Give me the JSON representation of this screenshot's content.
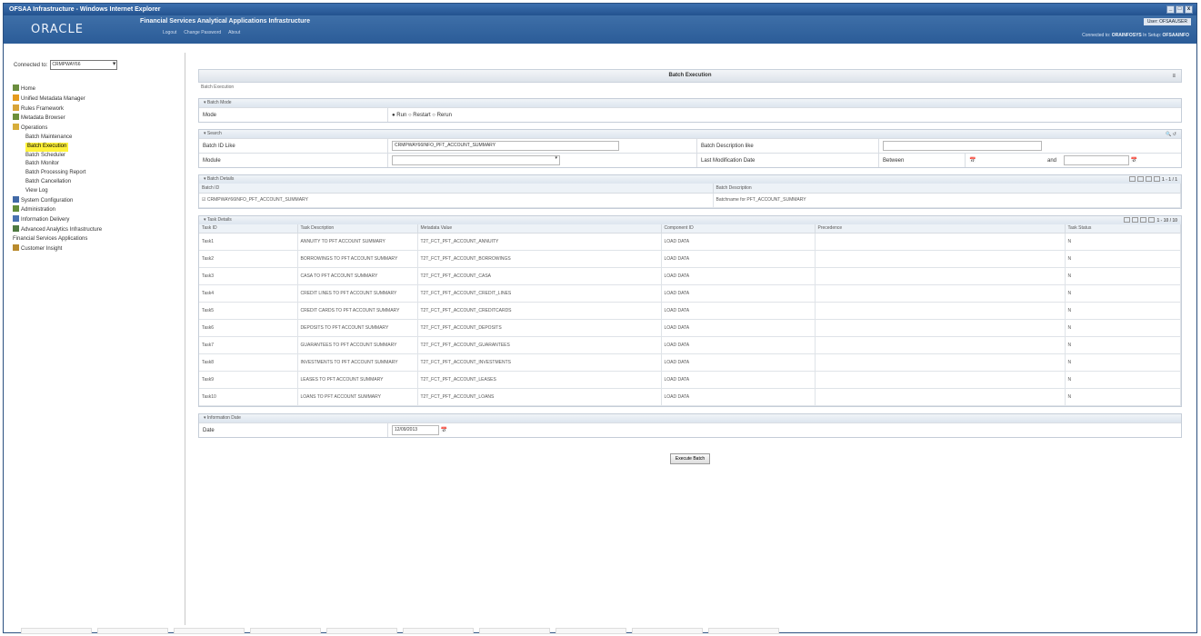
{
  "window": {
    "title": "OFSAA Infrastructure - Windows Internet Explorer",
    "controls": [
      "_",
      "□",
      "x"
    ]
  },
  "banner": {
    "logo": "ORACLE",
    "app_title": "Financial Services Analytical Applications Infrastructure",
    "links": [
      "Logout",
      "Change Password",
      "About"
    ],
    "user_button": "User: OFSAAUSER",
    "status_connected_label": "Connected to: ",
    "status_connected_value": "ORAINFOSYS",
    "status_setup_label": "In Setup: ",
    "status_setup_value": "OFSAAINFO"
  },
  "left": {
    "connected_label": "Connected to:",
    "connected_value": "CRMPWAY66"
  },
  "nav": [
    {
      "label": "Home",
      "level": 1,
      "icon": "home-icon"
    },
    {
      "label": "Unified Metadata Manager",
      "level": 1,
      "icon": "metadata-icon"
    },
    {
      "label": "Rules Framework",
      "level": 1,
      "icon": "rules-icon"
    },
    {
      "label": "Metadata Browser",
      "level": 1,
      "icon": "browser-icon"
    },
    {
      "label": "Operations",
      "level": 1,
      "icon": "folder-icon"
    },
    {
      "label": "Batch Maintenance",
      "level": 2
    },
    {
      "label": "Batch Execution",
      "level": 2,
      "selected": true
    },
    {
      "label": "Batch Scheduler",
      "level": 2
    },
    {
      "label": "Batch Monitor",
      "level": 2
    },
    {
      "label": "Batch Processing Report",
      "level": 2
    },
    {
      "label": "Batch Cancellation",
      "level": 2
    },
    {
      "label": "View Log",
      "level": 2
    },
    {
      "label": "System Configuration",
      "level": 1,
      "icon": "system-icon"
    },
    {
      "label": "Administration",
      "level": 1,
      "icon": "admin-icon"
    },
    {
      "label": "Information Delivery",
      "level": 1,
      "icon": "info-icon"
    },
    {
      "label": "Advanced Analytics Infrastructure",
      "level": 1,
      "icon": "analytics-icon"
    },
    {
      "label": "Financial Services Applications",
      "level": 1
    },
    {
      "label": "Customer Insight",
      "level": 1,
      "icon": "customer-icon"
    }
  ],
  "page": {
    "title": "Batch Execution",
    "breadcrumb": "Batch Execution",
    "help_icon": "help-icon"
  },
  "batch_mode": {
    "section_title": "Batch Mode",
    "label": "Mode",
    "options": [
      "Run",
      "Restart",
      "Rerun"
    ],
    "selected": "Run"
  },
  "search": {
    "section_title": "Search",
    "batch_id_label": "Batch ID Like",
    "batch_id_value": "CRMPWAY66INFO_PFT_ACCOUNT_SUMMARY",
    "batch_desc_label": "Batch Description like",
    "module_label": "Module",
    "last_mod_label": "Last Modification Date",
    "between_label": "Between",
    "and_label": "and"
  },
  "batch_details": {
    "section_title": "Batch Details",
    "columns": [
      "Batch ID",
      "Batch Description"
    ],
    "rows": [
      [
        "CRMPWAY66INFO_PFT_ACCOUNT_SUMMARY",
        "Batchname for PFT_ACCOUNT_SUMMARY"
      ]
    ],
    "pager": "1 - 1 / 1"
  },
  "task_details": {
    "section_title": "Task Details",
    "columns": [
      "Task ID",
      "Task Description",
      "Metadata Value",
      "Component ID",
      "Precedence",
      "Task Status"
    ],
    "rows": [
      [
        "Task1",
        "ANNUITY TO PFT ACCOUNT SUMMARY",
        "T2T_FCT_PFT_ACCOUNT_ANNUITY",
        "LOAD DATA",
        "",
        "N"
      ],
      [
        "Task2",
        "BORROWINGS TO PFT ACCOUNT SUMMARY",
        "T2T_FCT_PFT_ACCOUNT_BORROWINGS",
        "LOAD DATA",
        "",
        "N"
      ],
      [
        "Task3",
        "CASA TO PFT ACCOUNT SUMMARY",
        "T2T_FCT_PFT_ACCOUNT_CASA",
        "LOAD DATA",
        "",
        "N"
      ],
      [
        "Task4",
        "CREDIT LINES TO PFT ACCOUNT SUMMARY",
        "T2T_FCT_PFT_ACCOUNT_CREDIT_LINES",
        "LOAD DATA",
        "",
        "N"
      ],
      [
        "Task5",
        "CREDIT CARDS TO PFT ACCOUNT SUMMARY",
        "T2T_FCT_PFT_ACCOUNT_CREDITCARDS",
        "LOAD DATA",
        "",
        "N"
      ],
      [
        "Task6",
        "DEPOSITS TO PFT ACCOUNT SUMMARY",
        "T2T_FCT_PFT_ACCOUNT_DEPOSITS",
        "LOAD DATA",
        "",
        "N"
      ],
      [
        "Task7",
        "GUARANTEES TO PFT ACCOUNT SUMMARY",
        "T2T_FCT_PFT_ACCOUNT_GUARANTEES",
        "LOAD DATA",
        "",
        "N"
      ],
      [
        "Task8",
        "INVESTMENTS TO PFT ACCOUNT SUMMARY",
        "T2T_FCT_PFT_ACCOUNT_INVESTMENTS",
        "LOAD DATA",
        "",
        "N"
      ],
      [
        "Task9",
        "LEASES TO PFT ACCOUNT SUMMARY",
        "T2T_FCT_PFT_ACCOUNT_LEASES",
        "LOAD DATA",
        "",
        "N"
      ],
      [
        "Task10",
        "LOANS TO PFT ACCOUNT SUMMARY",
        "T2T_FCT_PFT_ACCOUNT_LOANS",
        "LOAD DATA",
        "",
        "N"
      ]
    ],
    "pager": "1 - 10 / 10"
  },
  "information_date": {
    "section_title": "Information Date",
    "label": "Date",
    "value": "12/09/2013"
  },
  "actions": {
    "execute_label": "Execute Batch"
  },
  "colors": {
    "accent": "#2b5c98",
    "selection": "#fff23a"
  }
}
